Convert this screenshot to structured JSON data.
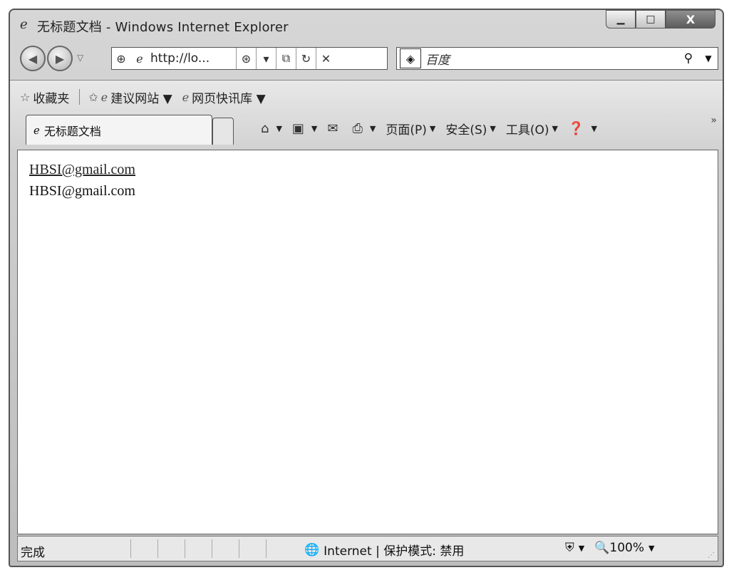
{
  "window": {
    "title": "无标题文档 - Windows Internet Explorer",
    "min_glyph": "▭",
    "max_glyph": "□",
    "close_glyph": "X"
  },
  "nav": {
    "address": "http://lo...",
    "search_placeholder": "百度"
  },
  "favorites": {
    "label": "收藏夹",
    "items": [
      {
        "label": "建议网站 ▼",
        "icon": "ie-icon"
      },
      {
        "label": "网页快讯库 ▼",
        "icon": "ie-icon"
      }
    ]
  },
  "tab": {
    "title": "无标题文档"
  },
  "commands": {
    "page": "页面(P)",
    "safety": "安全(S)",
    "tools": "工具(O)",
    "more": "»"
  },
  "content": {
    "lines": [
      "HBSI@gmail.com",
      "HBSI@gmail.com"
    ]
  },
  "status": {
    "text": "完成",
    "zone": "Internet | 保护模式: 禁用",
    "zoom": "100%"
  }
}
